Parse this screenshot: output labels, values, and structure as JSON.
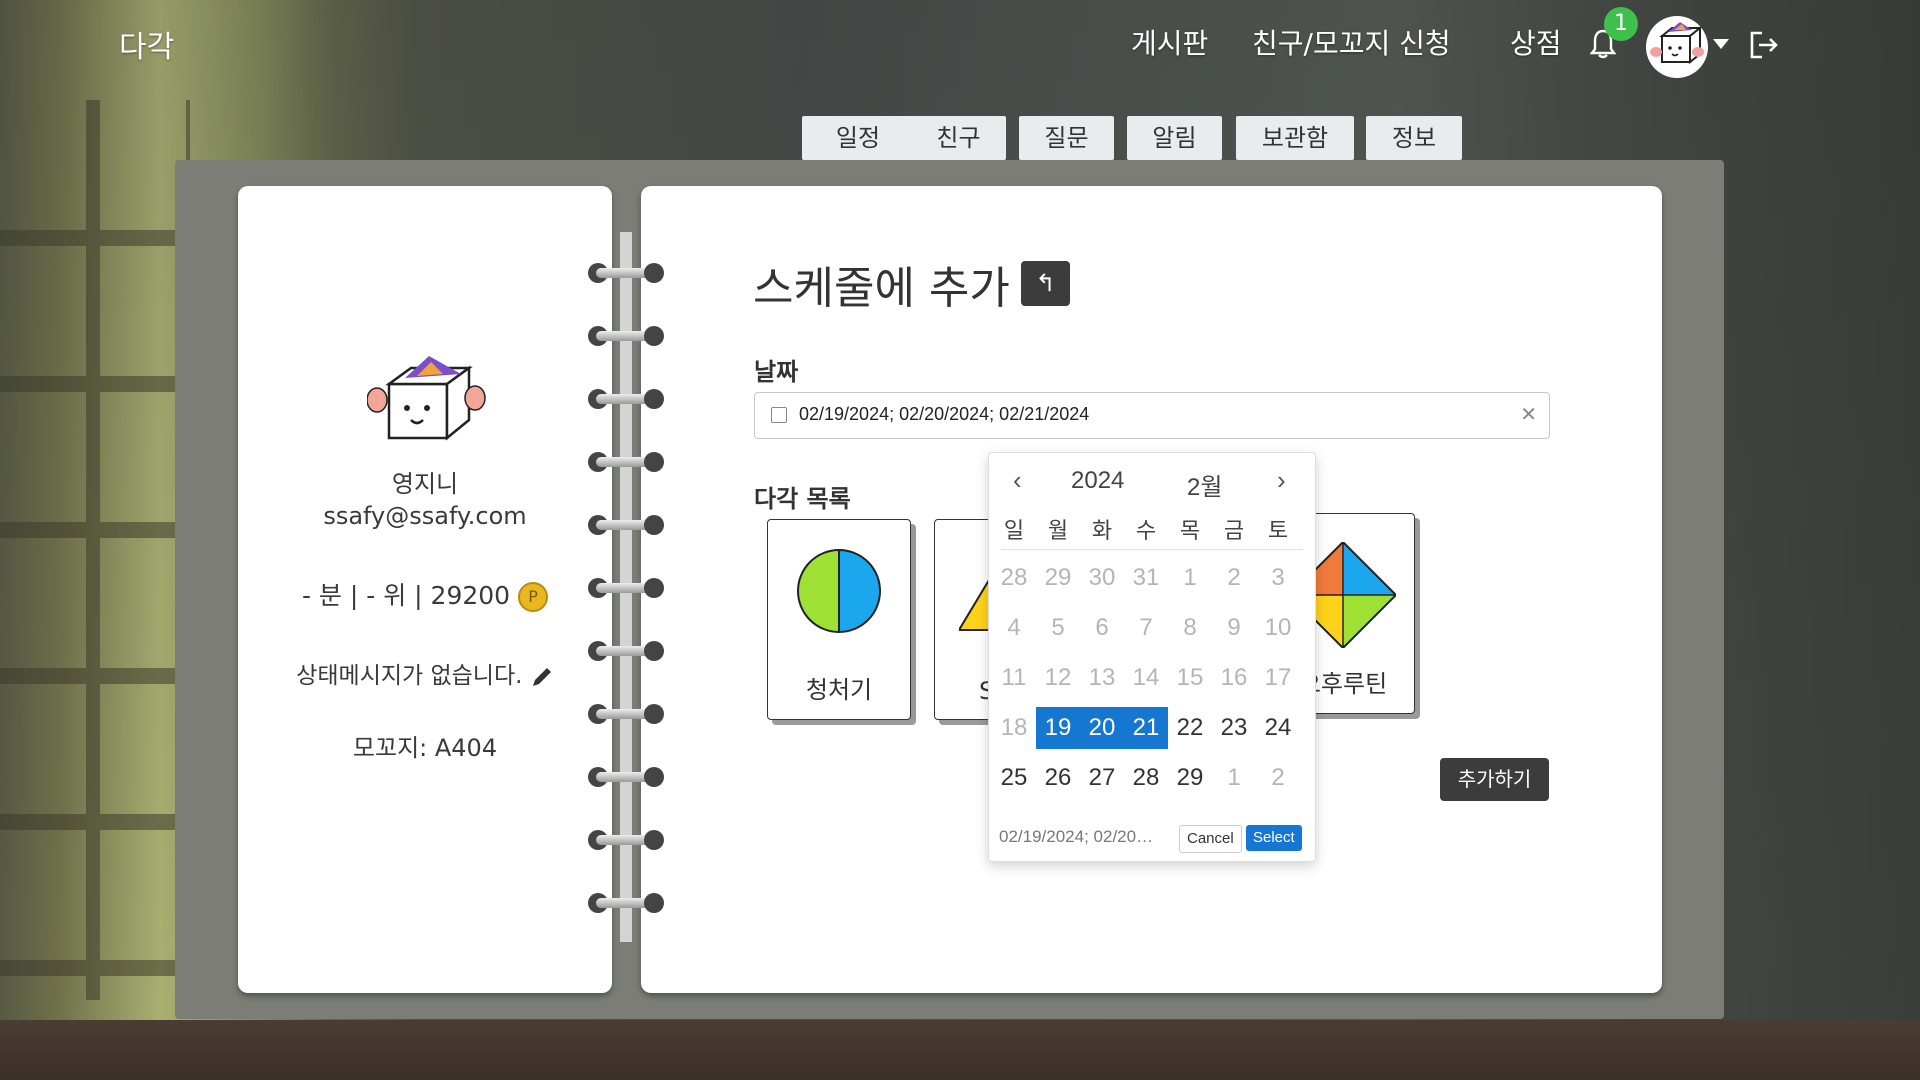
{
  "nav": {
    "brand": "다각",
    "links": [
      "게시판",
      "친구/모꼬지 신청",
      "상점"
    ],
    "notification_count": "1"
  },
  "tabs": [
    "일정",
    "친구",
    "질문",
    "알림",
    "보관함",
    "정보"
  ],
  "profile": {
    "name": "영지니",
    "email": "ssafy@ssafy.com",
    "stats": "- 분 | - 위 | 29200",
    "coin_symbol": "P",
    "status_message": "상태메시지가 없습니다.",
    "mokkoji": "모꼬지: A404"
  },
  "form": {
    "title": "스케줄에 추가",
    "date_label": "날짜",
    "date_value": "02/19/2024; 02/20/2024; 02/21/2024",
    "list_label": "다각 목록",
    "cards": [
      {
        "label": "청처기"
      },
      {
        "label": "S"
      },
      {
        "label": "오후루틴"
      }
    ],
    "add_button": "추가하기"
  },
  "datepicker": {
    "year": "2024",
    "month": "2월",
    "weekdays": [
      "일",
      "월",
      "화",
      "수",
      "목",
      "금",
      "토"
    ],
    "weeks": [
      [
        [
          "28",
          1
        ],
        [
          "29",
          1
        ],
        [
          "30",
          1
        ],
        [
          "31",
          1
        ],
        [
          "1",
          1
        ],
        [
          "2",
          1
        ],
        [
          "3",
          1
        ]
      ],
      [
        [
          "4",
          1
        ],
        [
          "5",
          1
        ],
        [
          "6",
          1
        ],
        [
          "7",
          1
        ],
        [
          "8",
          1
        ],
        [
          "9",
          1
        ],
        [
          "10",
          1
        ]
      ],
      [
        [
          "11",
          1
        ],
        [
          "12",
          1
        ],
        [
          "13",
          1
        ],
        [
          "14",
          1
        ],
        [
          "15",
          1
        ],
        [
          "16",
          1
        ],
        [
          "17",
          1
        ]
      ],
      [
        [
          "18",
          1
        ],
        [
          "19",
          2
        ],
        [
          "20",
          2
        ],
        [
          "21",
          2
        ],
        [
          "22",
          0
        ],
        [
          "23",
          0
        ],
        [
          "24",
          0
        ]
      ],
      [
        [
          "25",
          0
        ],
        [
          "26",
          0
        ],
        [
          "27",
          0
        ],
        [
          "28",
          0
        ],
        [
          "29",
          0
        ],
        [
          "1",
          1
        ],
        [
          "2",
          1
        ]
      ]
    ],
    "footer_value": "02/19/2024; 02/20…",
    "cancel_label": "Cancel",
    "select_label": "Select"
  },
  "colors": {
    "accent": "#1677d3",
    "badge": "#3fbf4c",
    "dark_button": "#3c3c3c"
  }
}
